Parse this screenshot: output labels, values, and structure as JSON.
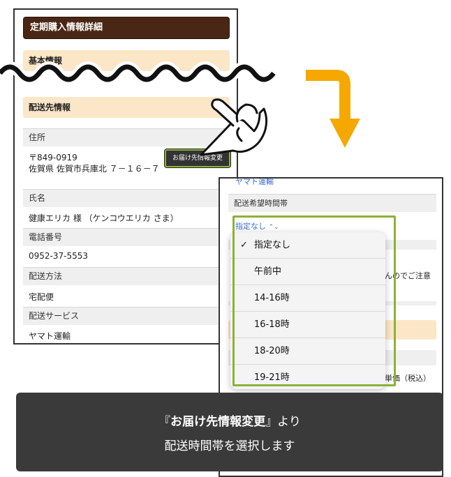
{
  "left": {
    "title": "定期購入情報詳細",
    "section_basic": "基本情報",
    "section_delivery": "配送先情報",
    "address_label": "住所",
    "postal": "〒849-0919",
    "address": "佐賀県 佐賀市兵庫北 ７－１６－７",
    "change_button": "お届け先情報変更",
    "name_label": "氏名",
    "name_value": "健康エリカ 様 （ケンコウエリカ さま）",
    "phone_label": "電話番号",
    "phone_value": "0952-37-5553",
    "method_label": "配送方法",
    "method_value": "宅配便",
    "service_label": "配送サービス",
    "service_value": "ヤマト運輸"
  },
  "right": {
    "top_partial": "ヤマト運輸",
    "time_label": "配送希望時間帯",
    "select_value": "指定なし",
    "bg_note": "んのでご注意",
    "bg_unit": "単価（税込）",
    "options": [
      {
        "label": "指定なし",
        "checked": true
      },
      {
        "label": "午前中",
        "checked": false
      },
      {
        "label": "14-16時",
        "checked": false
      },
      {
        "label": "16-18時",
        "checked": false
      },
      {
        "label": "18-20時",
        "checked": false
      },
      {
        "label": "19-21時",
        "checked": false
      }
    ]
  },
  "caption": {
    "line1_open": "『",
    "line1_bold": "お届け先情報変更",
    "line1_close": "』より",
    "line2": "配送時間帯を選択します"
  },
  "colors": {
    "header_brown": "#4a2714",
    "section_beige": "#fbe6c7",
    "highlight_green": "#8bb23a",
    "arrow_orange": "#f5a800",
    "caption_bg": "#3a3a3a"
  }
}
